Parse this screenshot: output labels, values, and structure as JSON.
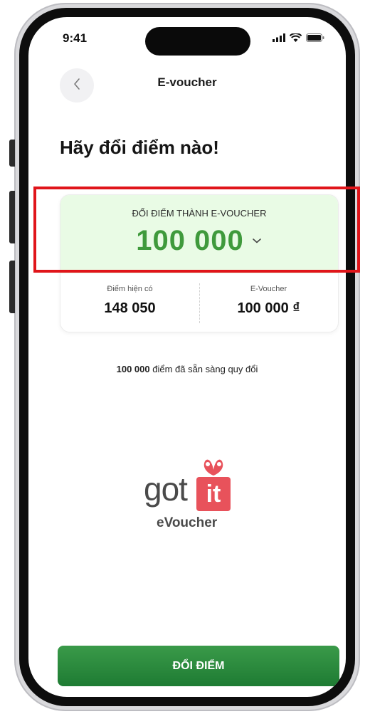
{
  "status_bar": {
    "time": "9:41"
  },
  "nav": {
    "title": "E-voucher"
  },
  "heading": "Hãy đổi điểm nào!",
  "exchange_card": {
    "label": "ĐỔI ĐIỂM THÀNH E-VOUCHER",
    "amount": "100 000",
    "available_label": "Điểm hiện có",
    "available_value": "148 050",
    "voucher_label": "E-Voucher",
    "voucher_value": "100 000 ₫"
  },
  "ready_text": {
    "points": "100 000",
    "suffix": " điểm đã sẵn sàng quy đổi"
  },
  "logo": {
    "got": "got",
    "it": "it",
    "sub": "eVoucher"
  },
  "primary_button": {
    "label": "ĐỔI ĐIỂM"
  },
  "colors": {
    "accent_green": "#3f9a3c",
    "card_highlight_bg": "#e9fbe5",
    "button_green": "#1e7b33",
    "logo_red": "#e8525b",
    "annotation_red": "#e0151a"
  }
}
